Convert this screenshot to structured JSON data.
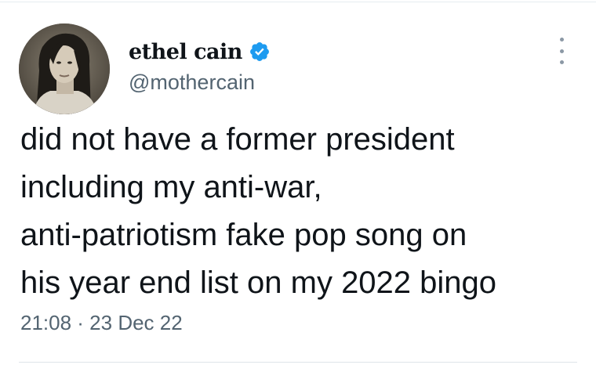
{
  "author": {
    "display_name": "ethel cain",
    "handle": "@mothercain",
    "verified": true,
    "verified_icon": "verified-badge-icon",
    "avatar": "profile-photo"
  },
  "menu": {
    "icon": "more-options-icon"
  },
  "tweet": {
    "lines": [
      "did not have a former president",
      "including my anti-war,",
      "anti-patriotism fake pop song on",
      "his year end list on my 2022 bingo"
    ]
  },
  "meta": {
    "timestamp": "21:08 · 23 Dec 22"
  },
  "colors": {
    "text": "#0f1419",
    "secondary": "#536471",
    "verified": "#1d9bf0",
    "divider": "#dfe5ea"
  }
}
